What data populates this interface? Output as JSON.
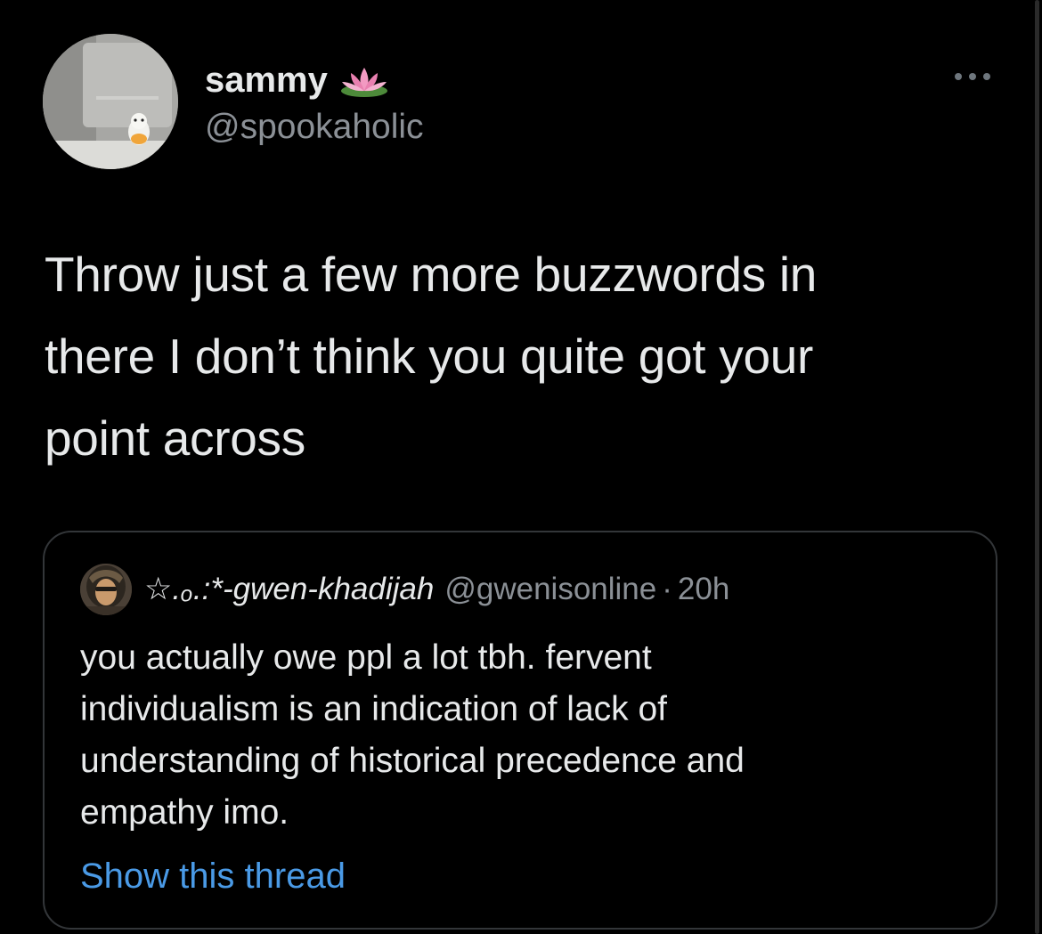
{
  "tweet": {
    "display_name": "sammy",
    "display_name_emoji": "lotus-emoji",
    "handle": "@spookaholic",
    "body_lines": [
      "Throw just a few more buzzwords in",
      "there I don’t think you quite got your",
      "point across"
    ]
  },
  "quote": {
    "display_name": "☆.ₒ.:*-gwen-khadijah",
    "handle": "@gwenisonline",
    "separator": "·",
    "time": "20h",
    "text_lines": [
      "you actually owe ppl a lot tbh. fervent",
      "individualism is an indication of lack of",
      "understanding of historical precedence and",
      "empathy imo."
    ],
    "show_thread_label": "Show this thread"
  },
  "icons": {
    "more": "more-horizontal-icon",
    "lotus": "lotus-icon"
  },
  "colors": {
    "background": "#000000",
    "text": "#e7e9ea",
    "secondary": "#8b9096",
    "link": "#4a9ae6",
    "border": "#333639"
  }
}
